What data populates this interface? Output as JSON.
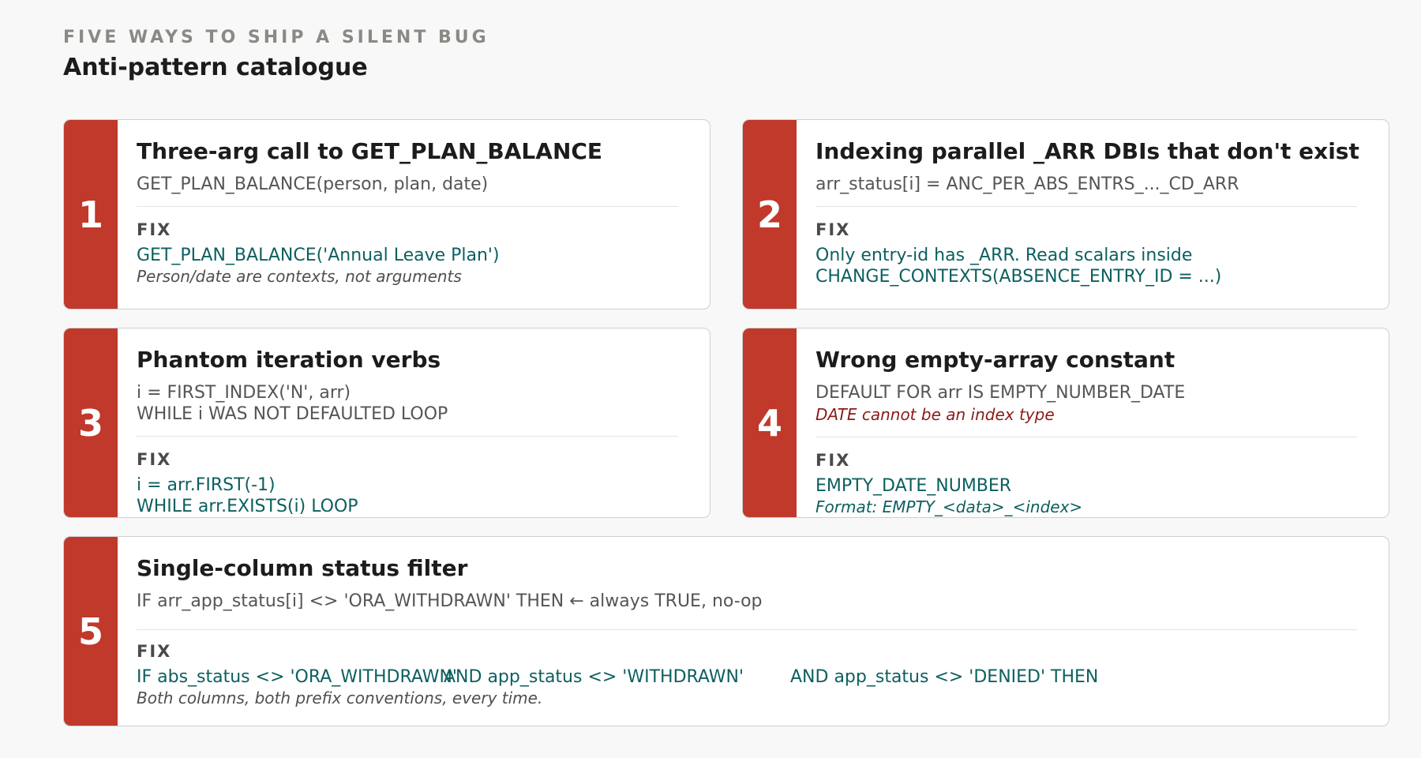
{
  "header": {
    "eyebrow": "FIVE WAYS TO SHIP A SILENT BUG",
    "title": "Anti-pattern catalogue"
  },
  "colors": {
    "accent": "#c0392b",
    "fix_text": "#0d5f5f",
    "warning_text": "#8b1a1a"
  },
  "cards": [
    {
      "number": "1",
      "title": "Three-arg call to GET_PLAN_BALANCE",
      "code": [
        "GET_PLAN_BALANCE(person, plan, date)"
      ],
      "fix_label": "FIX",
      "fix": [
        "GET_PLAN_BALANCE('Annual Leave Plan')"
      ],
      "note": "Person/date are contexts, not arguments"
    },
    {
      "number": "2",
      "title": "Indexing parallel _ARR DBIs that don't exist",
      "code": [
        "arr_status[i] = ANC_PER_ABS_ENTRS_..._CD_ARR"
      ],
      "fix_label": "FIX",
      "fix": [
        "Only entry-id has _ARR. Read scalars inside",
        "CHANGE_CONTEXTS(ABSENCE_ENTRY_ID = ...)"
      ]
    },
    {
      "number": "3",
      "title": "Phantom iteration verbs",
      "code": [
        "i = FIRST_INDEX('N', arr)",
        "WHILE i WAS NOT DEFAULTED LOOP"
      ],
      "fix_label": "FIX",
      "fix": [
        "i = arr.FIRST(-1)",
        "WHILE arr.EXISTS(i) LOOP"
      ]
    },
    {
      "number": "4",
      "title": "Wrong empty-array constant",
      "code": [
        "DEFAULT FOR arr IS EMPTY_NUMBER_DATE"
      ],
      "warning": "DATE cannot be an index type",
      "fix_label": "FIX",
      "fix": [
        "EMPTY_DATE_NUMBER"
      ],
      "note": "Format: EMPTY_<data>_<index>"
    },
    {
      "number": "5",
      "title": "Single-column status filter",
      "code": [
        "IF arr_app_status[i] <> 'ORA_WITHDRAWN' THEN ← always TRUE, no-op"
      ],
      "fix_label": "FIX",
      "fix": [
        "IF abs_status <> 'ORA_WITHDRAWN'",
        "AND app_status <> 'WITHDRAWN'",
        "AND app_status <> 'DENIED' THEN"
      ],
      "note": "Both columns, both prefix conventions, every time."
    }
  ]
}
